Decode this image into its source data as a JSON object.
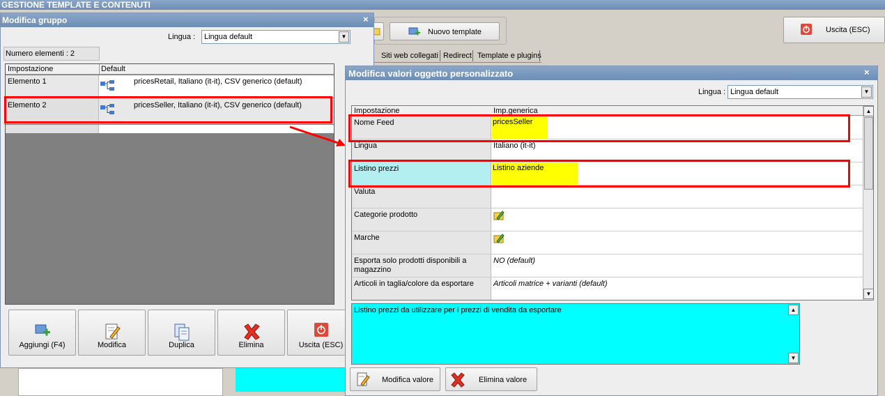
{
  "app": {
    "title": "GESTIONE TEMPLATE E CONTENUTI",
    "new_template": "Nuovo template",
    "exit": "Uscita (ESC)",
    "tabs": [
      "Siti web collegati",
      "Redirect",
      "Template e plugins"
    ]
  },
  "group_dialog": {
    "title": "Modifica gruppo",
    "lang_label": "Lingua :",
    "lang_value": "Lingua default",
    "count_label": "Numero elementi : 2",
    "columns": [
      "Impostazione",
      "Default"
    ],
    "rows": [
      {
        "setting": "Elemento 1",
        "value": "pricesRetail, Italiano (it-it), CSV generico (default)"
      },
      {
        "setting": "Elemento 2",
        "value": "pricesSeller, Italiano (it-it), CSV generico (default)"
      }
    ],
    "buttons": {
      "add": "Aggiungi (F4)",
      "edit": "Modifica",
      "duplicate": "Duplica",
      "delete": "Elimina",
      "exit": "Uscita (ESC)"
    }
  },
  "custom_dialog": {
    "title": "Modifica valori oggetto personalizzato",
    "lang_label": "Lingua :",
    "lang_value": "Lingua default",
    "columns": [
      "Impostazione",
      "Imp.generica"
    ],
    "rows": [
      {
        "setting": "Nome Feed",
        "value": "pricesSeller"
      },
      {
        "setting": "Lingua",
        "value": "Italiano (it-it)"
      },
      {
        "setting": "Listino prezzi",
        "value": "Listino aziende"
      },
      {
        "setting": "Valuta",
        "value": ""
      },
      {
        "setting": "Categorie prodotto",
        "value": ""
      },
      {
        "setting": "Marche",
        "value": ""
      },
      {
        "setting": "Esporta solo prodotti disponibili a magazzino",
        "value": "NO (default)"
      },
      {
        "setting": "Articoli in taglia/colore da esportare",
        "value": "Articoli matrice + varianti (default)"
      }
    ],
    "description": "Listino prezzi da utilizzare per i prezzi di vendita da esportare",
    "buttons": {
      "edit_value": "Modifica valore",
      "delete_value": "Elimina valore"
    }
  },
  "colors": {
    "highlight": "#ff0000",
    "yellow": "#ffff00",
    "cyan": "#00ffff",
    "selected_row": "#b3eef0"
  }
}
